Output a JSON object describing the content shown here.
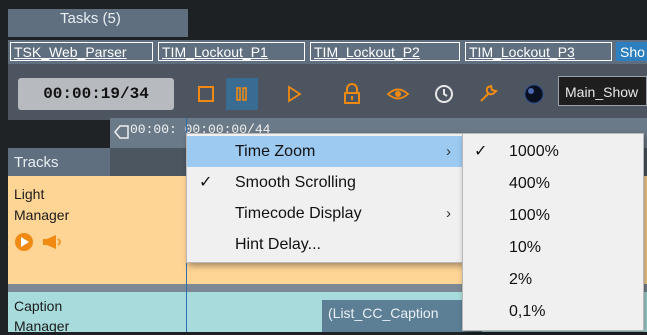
{
  "tasks_tab": {
    "label": "Tasks (5)"
  },
  "task_tabs": [
    {
      "label": "TSK_Web_Parser"
    },
    {
      "label": "TIM_Lockout_P1"
    },
    {
      "label": "TIM_Lockout_P2"
    },
    {
      "label": "TIM_Lockout_P3"
    },
    {
      "label": "Sho"
    }
  ],
  "toolbar": {
    "timecode": "00:00:19/34",
    "scene_value": "Main_Show",
    "icons": [
      "stop-icon",
      "pause-icon",
      "play-icon",
      "lock-icon",
      "eye-icon",
      "history-icon",
      "wrench-icon",
      "record-indicator-icon"
    ]
  },
  "ruler": {
    "label": "00:00: 00:00:00/44"
  },
  "tracks": {
    "header": "Tracks",
    "light": {
      "line1": "Light",
      "line2": "Manager"
    },
    "caption": {
      "line1": "Caption",
      "line2": "Manager"
    },
    "caption_clip": "(List_CC_Caption"
  },
  "context_menu": {
    "items": [
      {
        "label": "Time Zoom",
        "checked": false,
        "submenu": true,
        "highlighted": true
      },
      {
        "label": "Smooth Scrolling",
        "checked": true,
        "submenu": false
      },
      {
        "label": "Timecode Display",
        "checked": false,
        "submenu": true
      },
      {
        "label": "Hint Delay...",
        "checked": false,
        "submenu": false
      }
    ],
    "check_glyph": "✓",
    "arrow_glyph": "›"
  },
  "zoom_submenu": {
    "items": [
      {
        "label": "1000%",
        "checked": true
      },
      {
        "label": "400%",
        "checked": false
      },
      {
        "label": "100%",
        "checked": false
      },
      {
        "label": "10%",
        "checked": false
      },
      {
        "label": "2%",
        "checked": false
      },
      {
        "label": "0,1%",
        "checked": false
      }
    ]
  },
  "colors": {
    "accent": "#2d7fbf",
    "highlight": "#9ccaf1",
    "light_track": "#ffd596",
    "caption_track": "#a8dcdc",
    "icon_orange": "#f08a12"
  }
}
